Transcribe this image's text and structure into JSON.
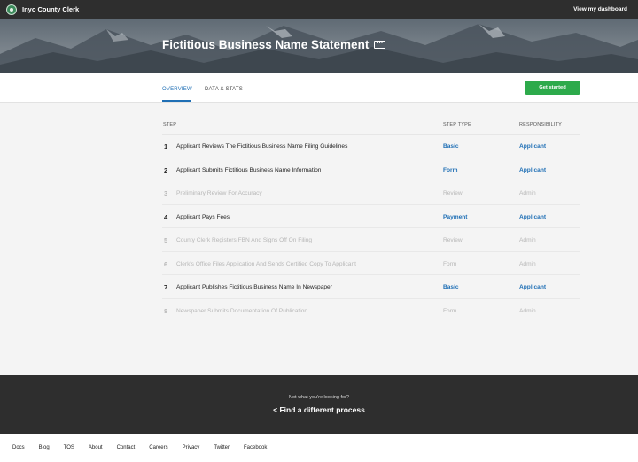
{
  "header": {
    "brand": "Inyo County Clerk",
    "dashboard_link": "View my dashboard"
  },
  "hero": {
    "title": "Fictitious Business Name Statement",
    "more_icon": "···"
  },
  "tabs": [
    {
      "label": "OVERVIEW",
      "active": true
    },
    {
      "label": "DATA & STATS",
      "active": false
    }
  ],
  "cta": {
    "label": "Get started",
    "color": "#2daa4b"
  },
  "table": {
    "headers": {
      "step": "STEP",
      "step_type": "STEP TYPE",
      "responsibility": "RESPONSIBILITY"
    },
    "rows": [
      {
        "num": "1",
        "name": "Applicant Reviews The Fictitious Business Name Filing Guidelines",
        "type": "Basic",
        "resp": "Applicant",
        "active": true
      },
      {
        "num": "2",
        "name": "Applicant Submits Fictitious Business Name Information",
        "type": "Form",
        "resp": "Applicant",
        "active": true
      },
      {
        "num": "3",
        "name": "Preliminary Review For Accuracy",
        "type": "Review",
        "resp": "Admin",
        "active": false
      },
      {
        "num": "4",
        "name": "Applicant Pays Fees",
        "type": "Payment",
        "resp": "Applicant",
        "active": true
      },
      {
        "num": "5",
        "name": "County Clerk Registers FBN And Signs Off On Filing",
        "type": "Review",
        "resp": "Admin",
        "active": false
      },
      {
        "num": "6",
        "name": "Clerk's Office Files Application And Sends Certified Copy To Applicant",
        "type": "Form",
        "resp": "Admin",
        "active": false
      },
      {
        "num": "7",
        "name": "Applicant Publishes Fictitious Business Name In Newspaper",
        "type": "Basic",
        "resp": "Applicant",
        "active": true
      },
      {
        "num": "8",
        "name": "Newspaper Submits Documentation Of Publication",
        "type": "Form",
        "resp": "Admin",
        "active": false
      }
    ]
  },
  "footer": {
    "not_looking": "Not what you're looking for?",
    "find_link": "< Find a different process",
    "links": [
      "Docs",
      "Blog",
      "TOS",
      "About",
      "Contact",
      "Careers",
      "Privacy",
      "Twitter",
      "Facebook"
    ]
  },
  "colors": {
    "accent": "#1f6fb5",
    "dark_bar": "#2e2e2e",
    "muted": "#b7b7b7"
  }
}
